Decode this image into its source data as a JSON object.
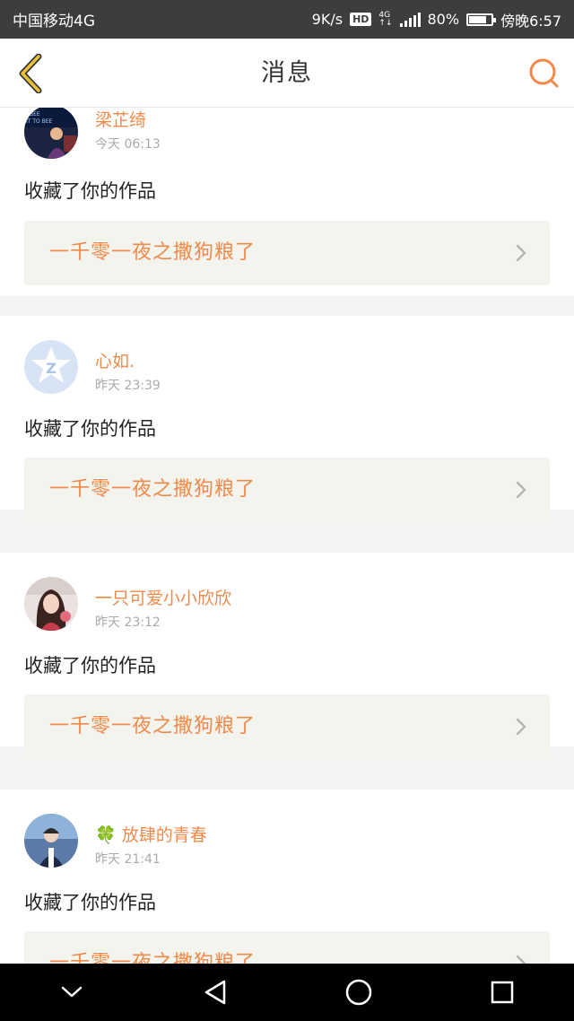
{
  "status_bar": {
    "carrier": "中国移动4G",
    "net_speed": "9K/s",
    "hd": "HD",
    "network": "4G",
    "battery_percent_text": "80%",
    "battery_level": 0.8,
    "time": "傍晚6:57"
  },
  "nav": {
    "title": "消息",
    "back_icon": "chevron-left-icon",
    "search_icon": "search-icon"
  },
  "notifications": [
    {
      "username": "梁芷绮",
      "time": "今天 06:13",
      "action": "收藏了你的作品",
      "work_title": "一千零一夜之撒狗粮了",
      "avatar_icon": "avatar-photo-dark"
    },
    {
      "username": "心如.",
      "time": "昨天 23:39",
      "action": "收藏了你的作品",
      "work_title": "一千零一夜之撒狗粮了",
      "avatar_icon": "avatar-default-star"
    },
    {
      "username": "一只可爱小小欣欣",
      "time": "昨天 23:12",
      "action": "收藏了你的作品",
      "work_title": "一千零一夜之撒狗粮了",
      "avatar_icon": "avatar-photo-girl"
    },
    {
      "username": "🍀 放肆的青春",
      "time": "昨天 21:41",
      "action": "收藏了你的作品",
      "work_title": "一千零一夜之撒狗粮了",
      "avatar_icon": "avatar-photo-boy"
    }
  ],
  "colors": {
    "accent": "#f08a4b",
    "back_icon": "#e8a53a"
  }
}
